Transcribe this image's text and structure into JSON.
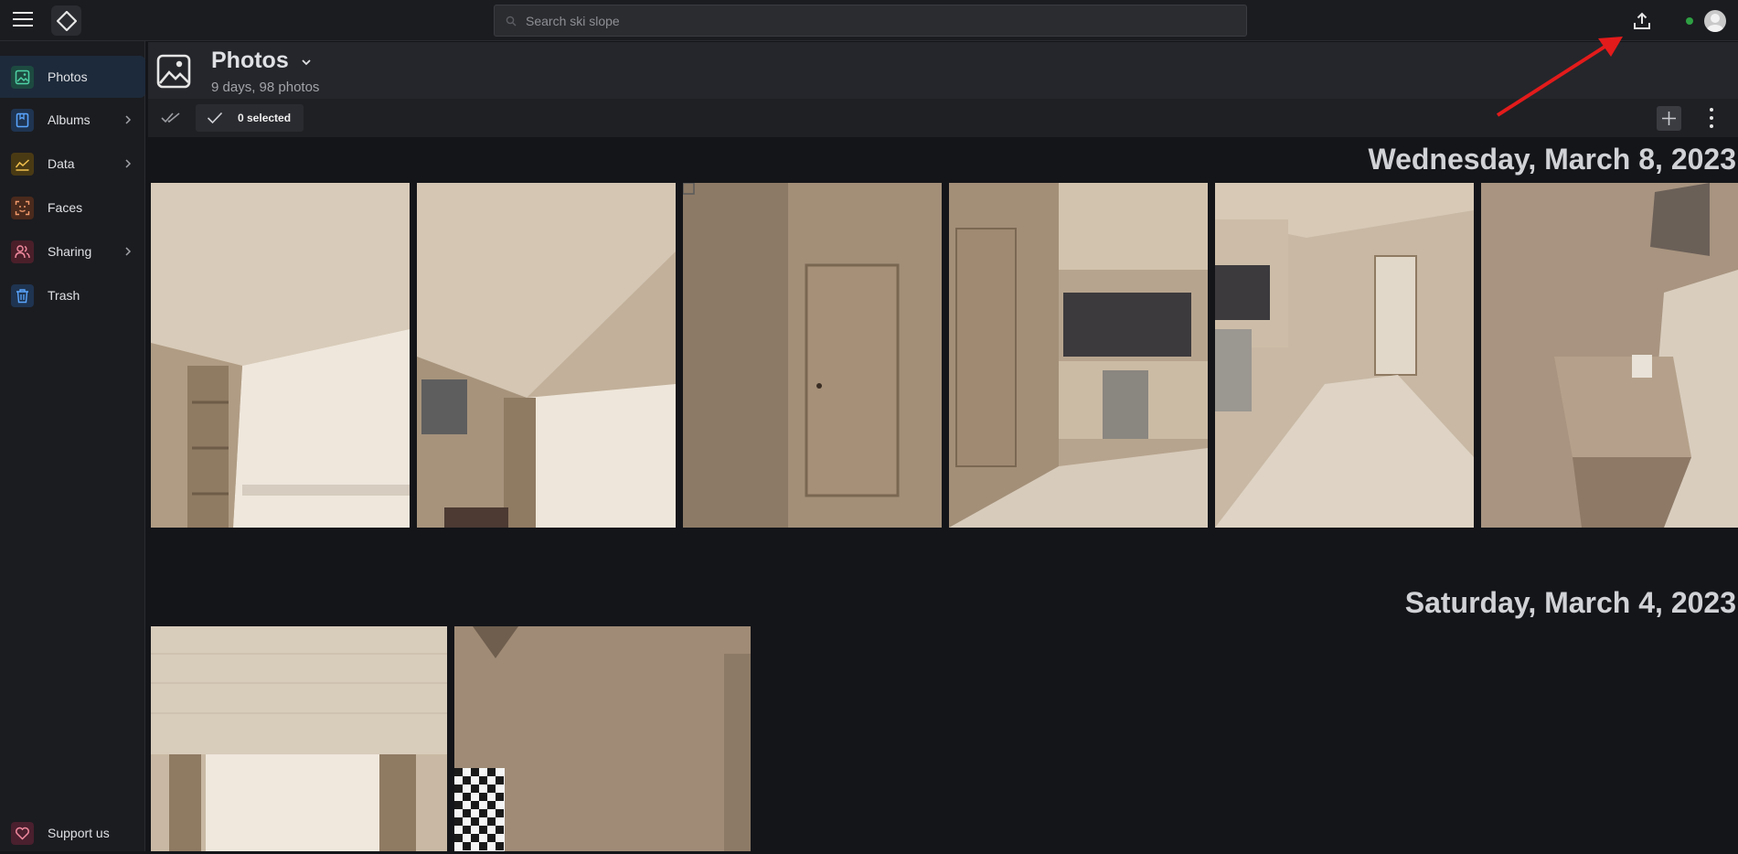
{
  "topbar": {
    "search_placeholder": "Search ski slope"
  },
  "sidebar": {
    "items": [
      {
        "label": "Photos",
        "icon": "photo-icon"
      },
      {
        "label": "Albums",
        "icon": "album-icon"
      },
      {
        "label": "Data",
        "icon": "chart-icon"
      },
      {
        "label": "Faces",
        "icon": "face-icon"
      },
      {
        "label": "Sharing",
        "icon": "people-icon"
      },
      {
        "label": "Trash",
        "icon": "trash-icon"
      }
    ],
    "support_label": "Support us"
  },
  "header": {
    "title": "Photos",
    "subtitle": "9 days, 98 photos"
  },
  "toolbar": {
    "selected_label": "0 selected"
  },
  "groups": [
    {
      "date": "Wednesday, March 8, 2023"
    },
    {
      "date": "Saturday, March 4, 2023"
    }
  ],
  "colors": {
    "accent": "#2ea043",
    "annotation": "#e31b1b"
  }
}
